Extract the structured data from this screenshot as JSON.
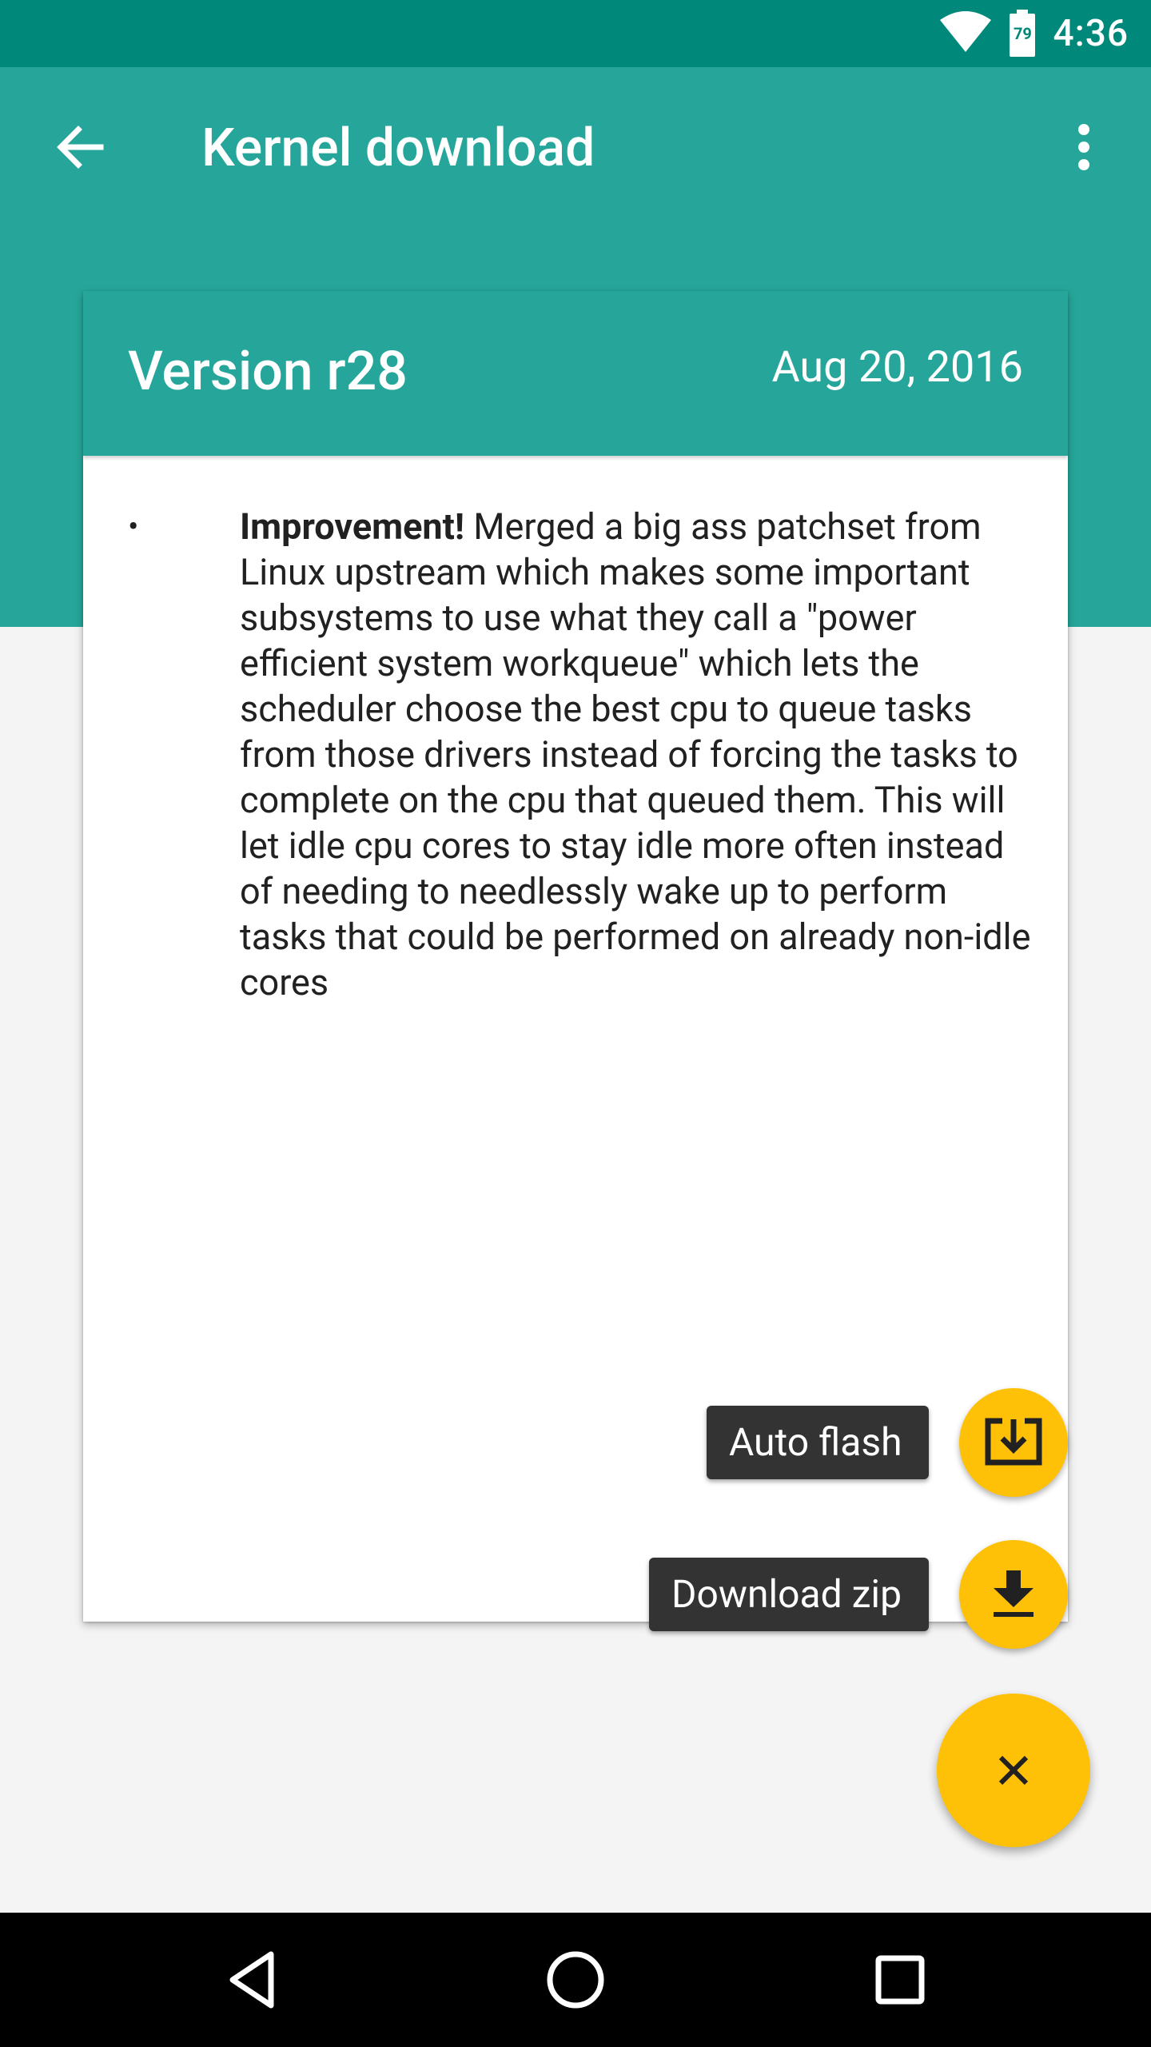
{
  "status_bar": {
    "time": "4:36",
    "battery_level": "79",
    "icons": [
      "wifi-icon",
      "battery-icon"
    ]
  },
  "toolbar": {
    "title": "Kernel download",
    "back_icon": "arrow-back-icon",
    "menu_icon": "more-vert-icon"
  },
  "card": {
    "version": "Version r28",
    "date": "Aug 20, 2016",
    "changelog": [
      {
        "bullet": "•",
        "tag": "Improvement!",
        "text": " Merged a big ass patchset from Linux upstream which makes some important subsystems to use what they call a \"power efficient system workqueue\" which lets the scheduler choose the best cpu to queue tasks from those drivers instead of forcing the tasks to complete on the cpu that queued them. This will let idle cpu cores to stay idle more often instead of needing to needlessly wake up to perform tasks that could be performed on already non-idle cores"
      }
    ]
  },
  "fab_menu": {
    "auto_flash_label": "Auto flash",
    "auto_flash_icon": "install-to-device-icon",
    "download_zip_label": "Download zip",
    "download_zip_icon": "download-icon",
    "close_icon": "close-icon"
  },
  "nav_bar": {
    "icons": [
      "back-triangle-icon",
      "home-circle-icon",
      "recents-square-icon"
    ]
  },
  "colors": {
    "status_bar": "#00897b",
    "primary": "#26a69a",
    "accent": "#ffc107",
    "background": "#f4f4f4",
    "label_bg": "#333333"
  }
}
